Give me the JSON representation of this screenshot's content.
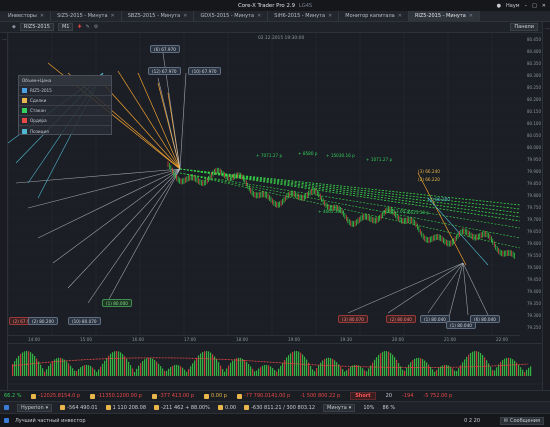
{
  "window": {
    "title": "Core-X Trader Pro 2.9",
    "subtitle": "LG4S",
    "user": "Наум"
  },
  "tabs": [
    {
      "label": "Инвесторы",
      "active": false
    },
    {
      "label": "SiZ5-2015 - Минута",
      "active": false
    },
    {
      "label": "SBZ5-2015 - Минута",
      "active": false
    },
    {
      "label": "GDX5-2015 - Минута",
      "active": false
    },
    {
      "label": "SiH6-2015 - Минута",
      "active": false
    },
    {
      "label": "Монитор капитала",
      "active": false
    },
    {
      "label": "RIZ5-2015 - Минута",
      "active": true
    }
  ],
  "chart_toolbar": {
    "symbol": "RIZ5-2015",
    "tf": "M1",
    "timestamp_label": "02.12.2015 19:30:00",
    "right_button": "Панели"
  },
  "indicator_panel": {
    "title": "Объем+Цена",
    "rows": [
      "RIZ5-2015",
      "Сделки",
      "Стакан",
      "Ордера",
      "Позиция"
    ]
  },
  "price_axis": [
    "80.450",
    "80.400",
    "80.350",
    "80.300",
    "80.250",
    "80.200",
    "80.150",
    "80.100",
    "80.050",
    "80.000",
    "79.950",
    "79.900",
    "79.850",
    "79.800",
    "79.750",
    "79.700",
    "79.650",
    "79.600",
    "79.550",
    "79.500",
    "79.450",
    "79.400",
    "79.350",
    "79.300",
    "79.250"
  ],
  "time_axis": [
    "14:00",
    "15:00",
    "16:00",
    "17:00",
    "18:00",
    "19:00",
    "19:30",
    "20:00",
    "21:00",
    "22:00"
  ],
  "markers": [
    {
      "text": "(6) 67.970",
      "kind": "dark"
    },
    {
      "text": "(12) 67.970",
      "kind": "dark"
    },
    {
      "text": "(10) 67.970",
      "kind": "dark"
    },
    {
      "text": "(2) 67.960",
      "kind": "red"
    },
    {
      "text": "(1) 80.000",
      "kind": "green"
    },
    {
      "text": "(10) 80.070",
      "kind": "dark"
    },
    {
      "text": "(2) 80.200",
      "kind": "dark"
    },
    {
      "text": "(3) 80.070",
      "kind": "red"
    },
    {
      "text": "(2) 80.040",
      "kind": "red"
    },
    {
      "text": "(1) 80.040",
      "kind": "dark"
    },
    {
      "text": "(1) 80.040",
      "kind": "dark"
    },
    {
      "text": "(6) 80.040",
      "kind": "dark"
    }
  ],
  "annotations": [
    "+ 7071.27 p",
    "+ 8580 p",
    "+ 15030.16 p",
    "+ 6653.00 p",
    "+ 1071.27 p",
    "+ 6623.30 p",
    "+ 4665.30 p",
    "(3) 66.240",
    "(2) 66.220",
    "(1) 80.200"
  ],
  "status1": {
    "pct": "66.2 %",
    "pnl1": "-12025.8154.0 p",
    "pnl2": "-11350.1200.00 p",
    "pnl3": "-377 413.00 p",
    "pnl4": "0.00 p",
    "pnl5": "-77 790.0141.00 p",
    "pnl6": "-1 500 800.22 p",
    "side": "Short",
    "qty": "20",
    "lots": "-194",
    "value": "-5 752.00 p"
  },
  "status2": {
    "account": "Hyperion",
    "v1": "-564 490.01",
    "v2": "1 110 208.08",
    "v3": "-211 462 + 88.00%",
    "v4": "0.00",
    "v5": "-630 811.21 / 300 803.12",
    "timeframe": "Минута",
    "zoom": "10%",
    "pct2": "86 %"
  },
  "footer": {
    "message": "Лучший частный инвестор",
    "time": "0 2 20",
    "msgs": "Сообщения"
  },
  "colors": {
    "bg": "#1b1e24",
    "green_line": "#39d84a",
    "orange_line": "#f0a030",
    "cyan_line": "#4fb8d0",
    "white_line": "#c8ccd6",
    "red": "#ea4747"
  }
}
